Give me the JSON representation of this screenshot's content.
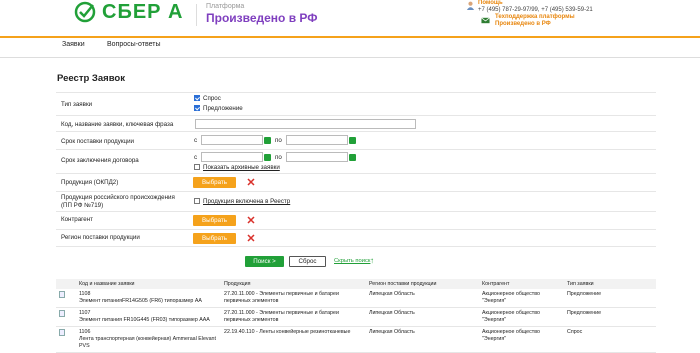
{
  "header": {
    "logo_text": "СБЕР А",
    "platform_label": "Платформа",
    "platform_name": "Произведено в РФ",
    "help_title": "Помощь",
    "help_phones": "+7 (495) 787-29-97/99, +7 (495) 539-59-21",
    "support_line1": "Техподдержка платформы",
    "support_line2": "Произведено в РФ"
  },
  "nav": {
    "items": [
      "Заявки",
      "Вопросы-ответы"
    ]
  },
  "page_title": "Реестр Заявок",
  "form": {
    "type_label": "Тип заявки",
    "type_opt1": "Спрос",
    "type_opt2": "Предложение",
    "code_label": "Код, название заявки, ключевая фраза",
    "delivery_label": "Срок поставки продукции",
    "contract_label": "Срок заключения договора",
    "from": "с",
    "to": "по",
    "archive_label": "Показать архивные заявки",
    "product_label": "Продукция (ОКПД2)",
    "russian_label_1": "Продукция российского происхождения",
    "russian_label_2": "(ПП РФ №719)",
    "russian_cb_label": "Продукция включена в Реестр",
    "counterparty_label": "Контрагент",
    "region_label": "Регион поставки продукции",
    "select_btn": "Выбрать"
  },
  "actions": {
    "search": "Поиск  >",
    "reset": "Сброс",
    "hide": "Скрыть поиск"
  },
  "table": {
    "headers": [
      "Код и название заявки",
      "Продукция",
      "Регион поставки продукции",
      "Контрагент",
      "Тип заявки"
    ],
    "rows": [
      {
        "code": "1108",
        "name": "Элемент питанияFR14G505 (FR6) типоразмер АА",
        "product": "27.20.11.000 - Элементы первичные и батареи первичных элементов",
        "region": "Липецкая Область",
        "contractor_1": "Акционерное общество",
        "contractor_2": "\"Энергия\"",
        "type": "Предложение"
      },
      {
        "code": "1107",
        "name": "Элемент питания FR10G445 (FR03) типоразмер ААА",
        "product": "27.20.11.000 - Элементы первичные и батареи первичных элементов",
        "region": "Липецкая Область",
        "contractor_1": "Акционерное общество",
        "contractor_2": "\"Энергия\"",
        "type": "Предложение"
      },
      {
        "code": "1106",
        "name": "Лента транспортерная (конвейерная) Ammeraal Elevant PVS",
        "product": "22.19.40.110 - Ленты конвейерные резинотканевые",
        "region": "Липецкая Область",
        "contractor_1": "Акционерное общество",
        "contractor_2": "\"Энергия\"",
        "type": "Спрос"
      }
    ]
  },
  "colors": {
    "brand_green": "#21a038",
    "accent_orange": "#f5a21b",
    "platform_purple": "#7f3fbf",
    "delete_red": "#d9312b"
  }
}
